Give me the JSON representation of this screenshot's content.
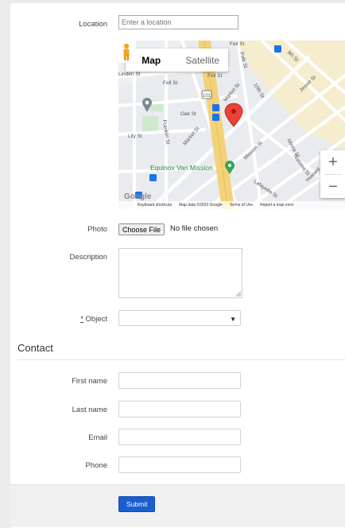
{
  "form": {
    "location_label": "Location",
    "location_placeholder": "Enter a location",
    "photo_label": "Photo",
    "choose_file_label": "Choose File",
    "file_status": "No file chosen",
    "description_label": "Description",
    "object_required_mark": "*",
    "object_label": "Object",
    "object_value": ""
  },
  "map": {
    "tab_map": "Map",
    "tab_satellite": "Satellite",
    "zoom_in": "+",
    "zoom_out": "−",
    "logo": "Google",
    "footer": {
      "shortcuts": "Keyboard shortcuts",
      "data": "Map data ©2023 Google",
      "terms": "Terms of Use",
      "report": "Report a map error"
    },
    "streets": {
      "s1": "Fell St",
      "s2": "Fell St",
      "s3": "Linden St",
      "s4": "Oak St",
      "s5": "Lily St",
      "s6": "Franklin St",
      "s7": "Market St",
      "s8": "Market St",
      "s9": "10th St",
      "s10": "9th St",
      "s11": "Jessie St",
      "s12": "Polk St",
      "s13": "Mission St",
      "s14": "Minna St",
      "s15": "Natoma St",
      "s16": "Lafayette St",
      "s17": "Howard",
      "s18": "101",
      "poi": "Equinox Van Mission"
    }
  },
  "contact": {
    "title": "Contact",
    "first_name_label": "First name",
    "last_name_label": "Last name",
    "email_label": "Email",
    "phone_label": "Phone"
  },
  "actions": {
    "submit_label": "Submit"
  },
  "colors": {
    "submit_bg": "#1a5fd0",
    "marker": "#ea4335",
    "poi": "#34a853"
  }
}
